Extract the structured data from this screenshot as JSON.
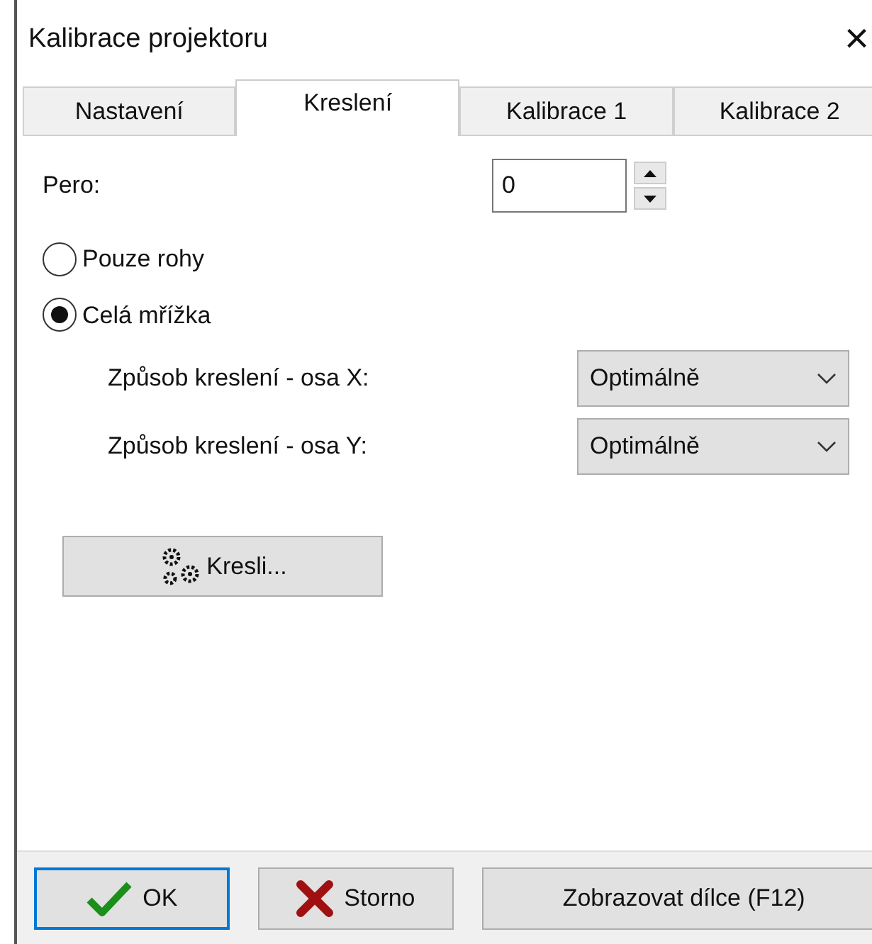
{
  "window": {
    "title": "Kalibrace projektoru",
    "close": "×"
  },
  "tabs": [
    {
      "label": "Nastavení",
      "selected": false
    },
    {
      "label": "Kreslení",
      "selected": true
    },
    {
      "label": "Kalibrace 1",
      "selected": false
    },
    {
      "label": "Kalibrace 2",
      "selected": false
    }
  ],
  "pen": {
    "label": "Pero:",
    "value": "0"
  },
  "radios": [
    {
      "label": "Pouze rohy",
      "selected": false
    },
    {
      "label": "Celá mřížka",
      "selected": true
    }
  ],
  "selects": [
    {
      "label": "Způsob kreslení - osa X:",
      "value": "Optimálně"
    },
    {
      "label": "Způsob kreslení - osa Y:",
      "value": "Optimálně"
    }
  ],
  "draw_button": "Kresli...",
  "footer": [
    {
      "kind": "ok",
      "label": "OK"
    },
    {
      "kind": "cancel",
      "label": "Storno"
    },
    {
      "kind": "plain",
      "label": "Zobrazovat dílce (F12)"
    }
  ]
}
